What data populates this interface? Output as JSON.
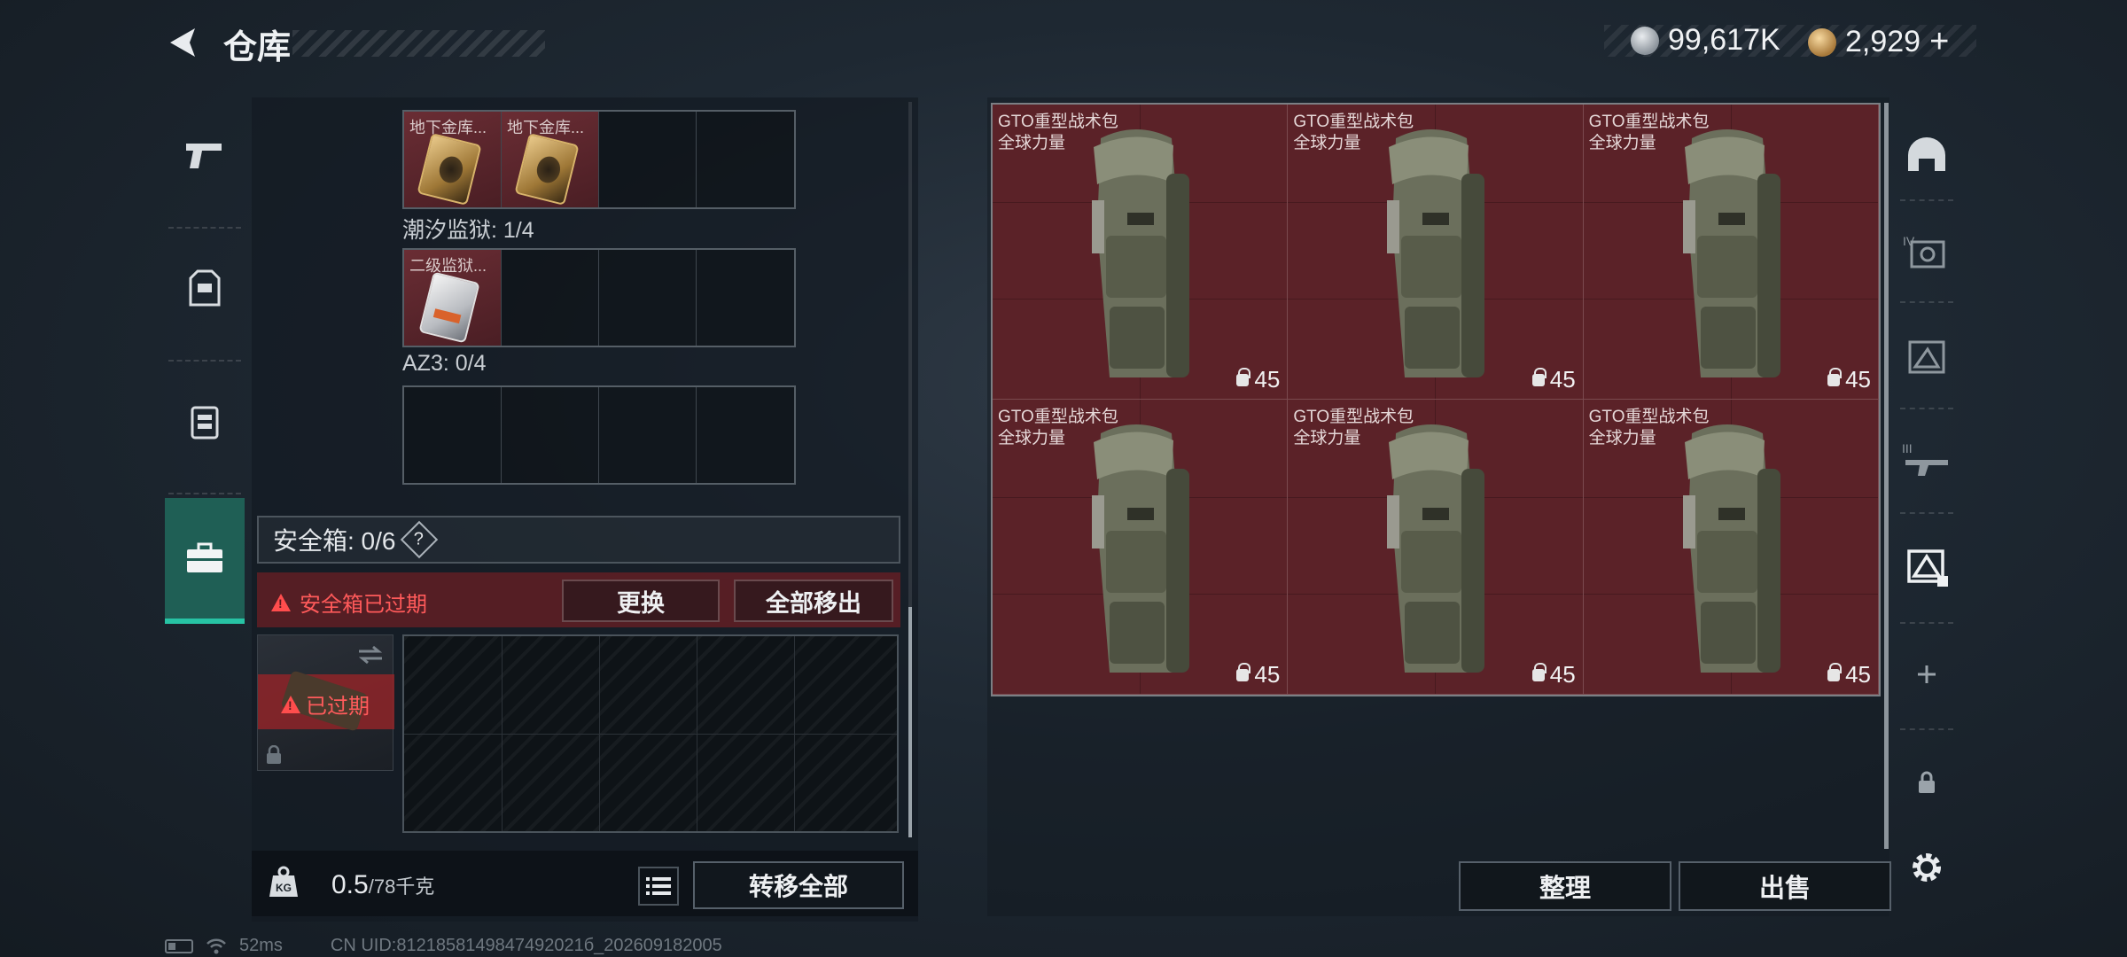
{
  "header": {
    "title": "仓库"
  },
  "currency": {
    "silver_amount": "99,617K",
    "gold_amount": "2,929",
    "add_label": "+"
  },
  "left_nav": {
    "icons": [
      "pistol-icon",
      "armor-icon",
      "vest-icon",
      "case-icon"
    ],
    "active_index": 3
  },
  "inventory": {
    "row1": {
      "items": [
        {
          "name": "地下金库..."
        },
        {
          "name": "地下金库..."
        }
      ]
    },
    "row2_label": "潮汐监狱: 1/4",
    "row2": {
      "items": [
        {
          "name": "二级监狱..."
        }
      ]
    },
    "row3_label": "AZ3: 0/4"
  },
  "safe_box": {
    "title": "安全箱: 0/6",
    "help": "?",
    "expired_message": "安全箱已过期",
    "replace_label": "更换",
    "remove_all_label": "全部移出",
    "slot_status": "已过期"
  },
  "footer_left": {
    "weight_value": "0.5",
    "weight_max": "/78千克",
    "transfer_all_label": "转移全部"
  },
  "storage": {
    "items": [
      {
        "name_line1": "GTO重型战术包",
        "name_line2": "全球力量",
        "count": "45"
      },
      {
        "name_line1": "GTO重型战术包",
        "name_line2": "全球力量",
        "count": "45"
      },
      {
        "name_line1": "GTO重型战术包",
        "name_line2": "全球力量",
        "count": "45"
      },
      {
        "name_line1": "GTO重型战术包",
        "name_line2": "全球力量",
        "count": "45"
      },
      {
        "name_line1": "GTO重型战术包",
        "name_line2": "全球力量",
        "count": "45"
      },
      {
        "name_line1": "GTO重型战术包",
        "name_line2": "全球力量",
        "count": "45"
      }
    ],
    "sort_label": "整理",
    "sell_label": "出售"
  },
  "right_nav": {
    "icons": [
      "helmet-icon",
      "rig-tier4-icon",
      "backpack-rig-icon",
      "rifle-tier3-icon",
      "storage-backpack-icon",
      "add-icon",
      "lock-icon",
      "settings-icon"
    ]
  },
  "status_bar": {
    "ping": "52ms",
    "uid": "CN UID:8121858149847492021б_202609182005"
  }
}
